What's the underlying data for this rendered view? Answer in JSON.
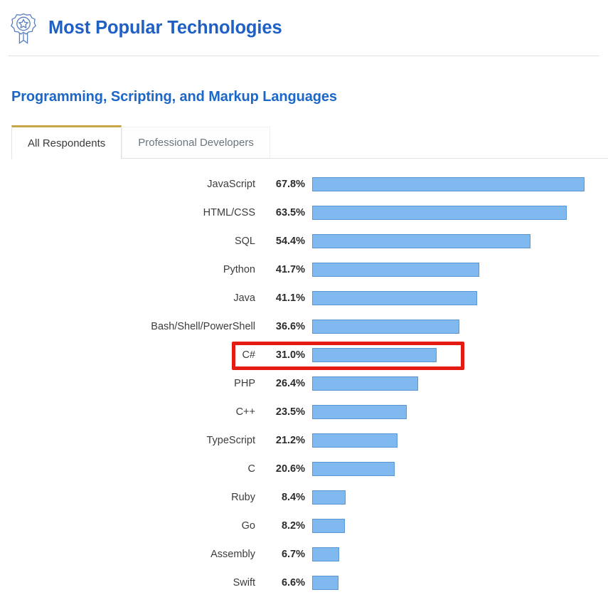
{
  "header": {
    "title": "Most Popular Technologies",
    "icon": "award-ribbon-icon"
  },
  "section": {
    "title": "Programming, Scripting, and Markup Languages"
  },
  "tabs": [
    {
      "label": "All Respondents",
      "active": true
    },
    {
      "label": "Professional Developers",
      "active": false
    }
  ],
  "colors": {
    "title_blue": "#2060c4",
    "section_blue": "#1d67c8",
    "bar_fill": "#7fb9f0",
    "bar_stroke": "#5b97d4",
    "active_tab_accent": "#c8a545",
    "highlight_red": "#e31b13"
  },
  "highlight": {
    "target_label": "C#",
    "color": "#e31b13"
  },
  "chart_data": {
    "type": "bar",
    "title": "Programming, Scripting, and Markup Languages",
    "subtitle": "All Respondents",
    "xlabel": "",
    "ylabel": "",
    "orientation": "horizontal",
    "grid": false,
    "legend": "none",
    "xlim": [
      0,
      70
    ],
    "value_suffix": "%",
    "categories": [
      "JavaScript",
      "HTML/CSS",
      "SQL",
      "Python",
      "Java",
      "Bash/Shell/PowerShell",
      "C#",
      "PHP",
      "C++",
      "TypeScript",
      "C",
      "Ruby",
      "Go",
      "Assembly",
      "Swift"
    ],
    "values": [
      67.8,
      63.5,
      54.4,
      41.7,
      41.1,
      36.6,
      31.0,
      26.4,
      23.5,
      21.2,
      20.6,
      8.4,
      8.2,
      6.7,
      6.6
    ],
    "labels": [
      "67.8%",
      "63.5%",
      "54.4%",
      "41.7%",
      "41.1%",
      "36.6%",
      "31.0%",
      "26.4%",
      "23.5%",
      "21.2%",
      "20.6%",
      "8.4%",
      "8.2%",
      "6.7%",
      "6.6%"
    ]
  }
}
